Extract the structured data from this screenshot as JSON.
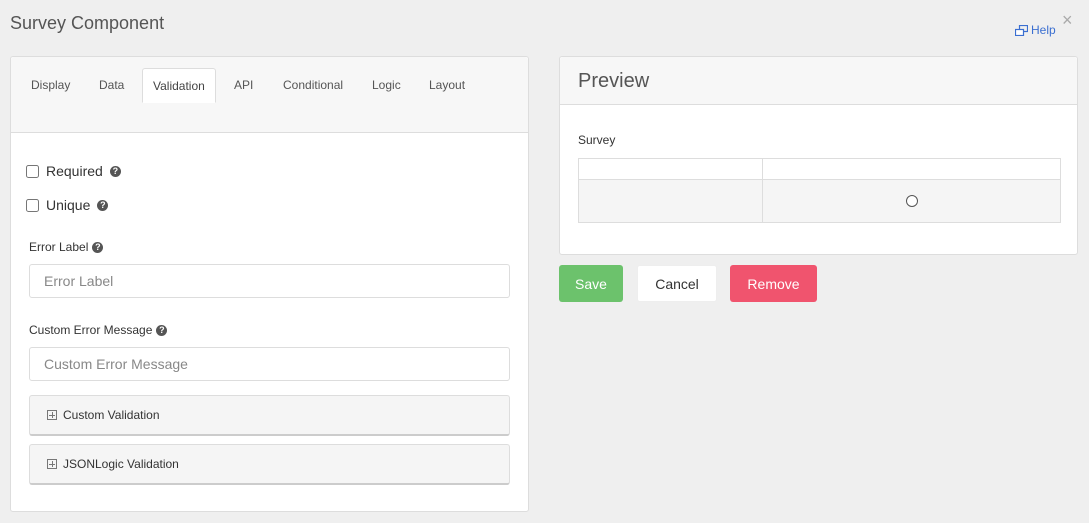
{
  "dialog": {
    "title": "Survey Component",
    "help_label": "Help",
    "close_glyph": "×"
  },
  "tabs": [
    {
      "label": "Display",
      "active": false
    },
    {
      "label": "Data",
      "active": false
    },
    {
      "label": "Validation",
      "active": true
    },
    {
      "label": "API",
      "active": false
    },
    {
      "label": "Conditional",
      "active": false
    },
    {
      "label": "Logic",
      "active": false
    },
    {
      "label": "Layout",
      "active": false
    }
  ],
  "validation": {
    "required_label": "Required",
    "required_checked": false,
    "unique_label": "Unique",
    "unique_checked": false,
    "error_label": {
      "label": "Error Label",
      "value": "",
      "placeholder": "Error Label"
    },
    "custom_error": {
      "label": "Custom Error Message",
      "value": "",
      "placeholder": "Custom Error Message"
    },
    "panels": [
      {
        "label": "Custom Validation"
      },
      {
        "label": "JSONLogic Validation"
      }
    ]
  },
  "preview": {
    "title": "Preview",
    "survey_label": "Survey"
  },
  "actions": {
    "save_label": "Save",
    "cancel_label": "Cancel",
    "remove_label": "Remove"
  },
  "colors": {
    "save": "#6cc26c",
    "remove": "#f0546e",
    "help_link": "#3b6fd1"
  },
  "icons": {
    "help": "external-link-icon",
    "tooltip": "question-circle-icon",
    "panel_toggle": "plus-square-icon",
    "radio": "radio-circle-icon"
  }
}
